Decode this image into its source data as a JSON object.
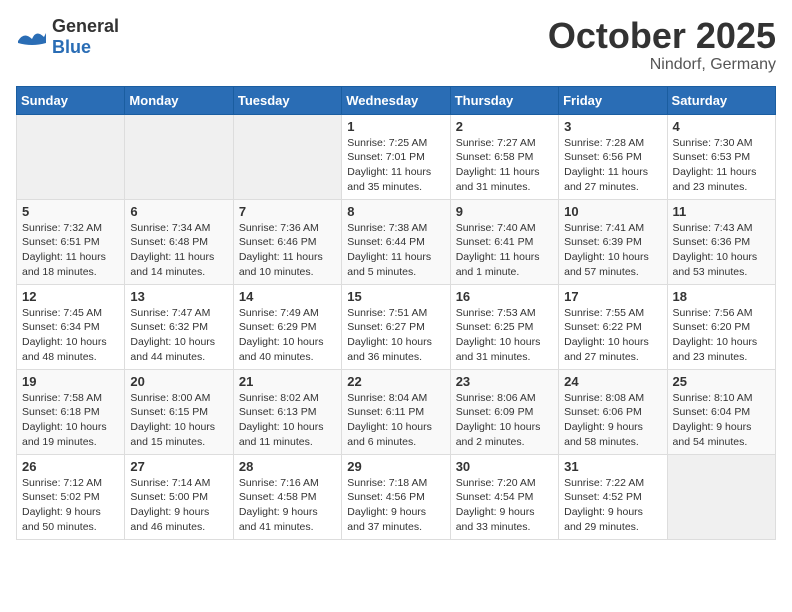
{
  "header": {
    "logo_general": "General",
    "logo_blue": "Blue",
    "month_title": "October 2025",
    "location": "Nindorf, Germany"
  },
  "weekdays": [
    "Sunday",
    "Monday",
    "Tuesday",
    "Wednesday",
    "Thursday",
    "Friday",
    "Saturday"
  ],
  "weeks": [
    [
      {
        "day": "",
        "info": ""
      },
      {
        "day": "",
        "info": ""
      },
      {
        "day": "",
        "info": ""
      },
      {
        "day": "1",
        "info": "Sunrise: 7:25 AM\nSunset: 7:01 PM\nDaylight: 11 hours\nand 35 minutes."
      },
      {
        "day": "2",
        "info": "Sunrise: 7:27 AM\nSunset: 6:58 PM\nDaylight: 11 hours\nand 31 minutes."
      },
      {
        "day": "3",
        "info": "Sunrise: 7:28 AM\nSunset: 6:56 PM\nDaylight: 11 hours\nand 27 minutes."
      },
      {
        "day": "4",
        "info": "Sunrise: 7:30 AM\nSunset: 6:53 PM\nDaylight: 11 hours\nand 23 minutes."
      }
    ],
    [
      {
        "day": "5",
        "info": "Sunrise: 7:32 AM\nSunset: 6:51 PM\nDaylight: 11 hours\nand 18 minutes."
      },
      {
        "day": "6",
        "info": "Sunrise: 7:34 AM\nSunset: 6:48 PM\nDaylight: 11 hours\nand 14 minutes."
      },
      {
        "day": "7",
        "info": "Sunrise: 7:36 AM\nSunset: 6:46 PM\nDaylight: 11 hours\nand 10 minutes."
      },
      {
        "day": "8",
        "info": "Sunrise: 7:38 AM\nSunset: 6:44 PM\nDaylight: 11 hours\nand 5 minutes."
      },
      {
        "day": "9",
        "info": "Sunrise: 7:40 AM\nSunset: 6:41 PM\nDaylight: 11 hours\nand 1 minute."
      },
      {
        "day": "10",
        "info": "Sunrise: 7:41 AM\nSunset: 6:39 PM\nDaylight: 10 hours\nand 57 minutes."
      },
      {
        "day": "11",
        "info": "Sunrise: 7:43 AM\nSunset: 6:36 PM\nDaylight: 10 hours\nand 53 minutes."
      }
    ],
    [
      {
        "day": "12",
        "info": "Sunrise: 7:45 AM\nSunset: 6:34 PM\nDaylight: 10 hours\nand 48 minutes."
      },
      {
        "day": "13",
        "info": "Sunrise: 7:47 AM\nSunset: 6:32 PM\nDaylight: 10 hours\nand 44 minutes."
      },
      {
        "day": "14",
        "info": "Sunrise: 7:49 AM\nSunset: 6:29 PM\nDaylight: 10 hours\nand 40 minutes."
      },
      {
        "day": "15",
        "info": "Sunrise: 7:51 AM\nSunset: 6:27 PM\nDaylight: 10 hours\nand 36 minutes."
      },
      {
        "day": "16",
        "info": "Sunrise: 7:53 AM\nSunset: 6:25 PM\nDaylight: 10 hours\nand 31 minutes."
      },
      {
        "day": "17",
        "info": "Sunrise: 7:55 AM\nSunset: 6:22 PM\nDaylight: 10 hours\nand 27 minutes."
      },
      {
        "day": "18",
        "info": "Sunrise: 7:56 AM\nSunset: 6:20 PM\nDaylight: 10 hours\nand 23 minutes."
      }
    ],
    [
      {
        "day": "19",
        "info": "Sunrise: 7:58 AM\nSunset: 6:18 PM\nDaylight: 10 hours\nand 19 minutes."
      },
      {
        "day": "20",
        "info": "Sunrise: 8:00 AM\nSunset: 6:15 PM\nDaylight: 10 hours\nand 15 minutes."
      },
      {
        "day": "21",
        "info": "Sunrise: 8:02 AM\nSunset: 6:13 PM\nDaylight: 10 hours\nand 11 minutes."
      },
      {
        "day": "22",
        "info": "Sunrise: 8:04 AM\nSunset: 6:11 PM\nDaylight: 10 hours\nand 6 minutes."
      },
      {
        "day": "23",
        "info": "Sunrise: 8:06 AM\nSunset: 6:09 PM\nDaylight: 10 hours\nand 2 minutes."
      },
      {
        "day": "24",
        "info": "Sunrise: 8:08 AM\nSunset: 6:06 PM\nDaylight: 9 hours\nand 58 minutes."
      },
      {
        "day": "25",
        "info": "Sunrise: 8:10 AM\nSunset: 6:04 PM\nDaylight: 9 hours\nand 54 minutes."
      }
    ],
    [
      {
        "day": "26",
        "info": "Sunrise: 7:12 AM\nSunset: 5:02 PM\nDaylight: 9 hours\nand 50 minutes."
      },
      {
        "day": "27",
        "info": "Sunrise: 7:14 AM\nSunset: 5:00 PM\nDaylight: 9 hours\nand 46 minutes."
      },
      {
        "day": "28",
        "info": "Sunrise: 7:16 AM\nSunset: 4:58 PM\nDaylight: 9 hours\nand 41 minutes."
      },
      {
        "day": "29",
        "info": "Sunrise: 7:18 AM\nSunset: 4:56 PM\nDaylight: 9 hours\nand 37 minutes."
      },
      {
        "day": "30",
        "info": "Sunrise: 7:20 AM\nSunset: 4:54 PM\nDaylight: 9 hours\nand 33 minutes."
      },
      {
        "day": "31",
        "info": "Sunrise: 7:22 AM\nSunset: 4:52 PM\nDaylight: 9 hours\nand 29 minutes."
      },
      {
        "day": "",
        "info": ""
      }
    ]
  ]
}
